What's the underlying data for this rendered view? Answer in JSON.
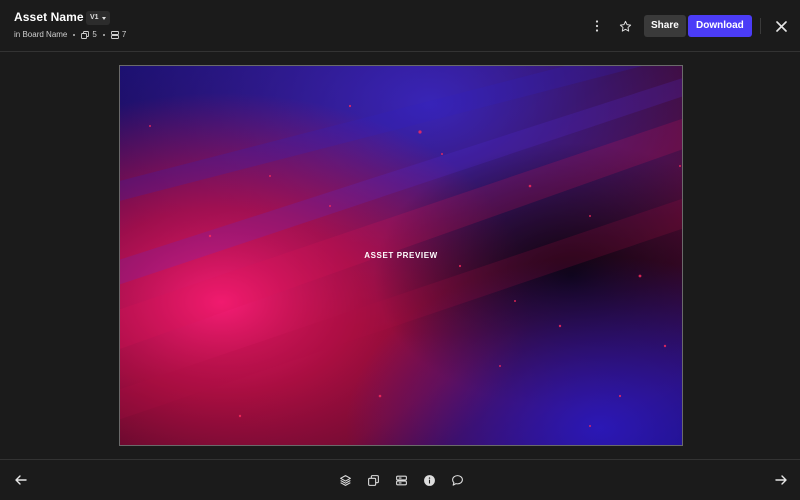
{
  "header": {
    "title": "Asset Name",
    "version": "V1",
    "board_prefix": "in",
    "board_name": "Board Name",
    "count_a": "5",
    "count_b": "7",
    "share_label": "Share",
    "download_label": "Download"
  },
  "preview": {
    "label": "ASSET PREVIEW"
  },
  "icons": {
    "more": "more-vertical-icon",
    "favorite": "star-icon",
    "close": "close-icon",
    "prev": "arrow-left-icon",
    "next": "arrow-right-icon",
    "tools": [
      "layers-icon",
      "copy-icon",
      "storage-icon",
      "info-icon",
      "comment-icon"
    ]
  },
  "colors": {
    "accent": "#4b3cf7",
    "background": "#1b1b1b"
  }
}
